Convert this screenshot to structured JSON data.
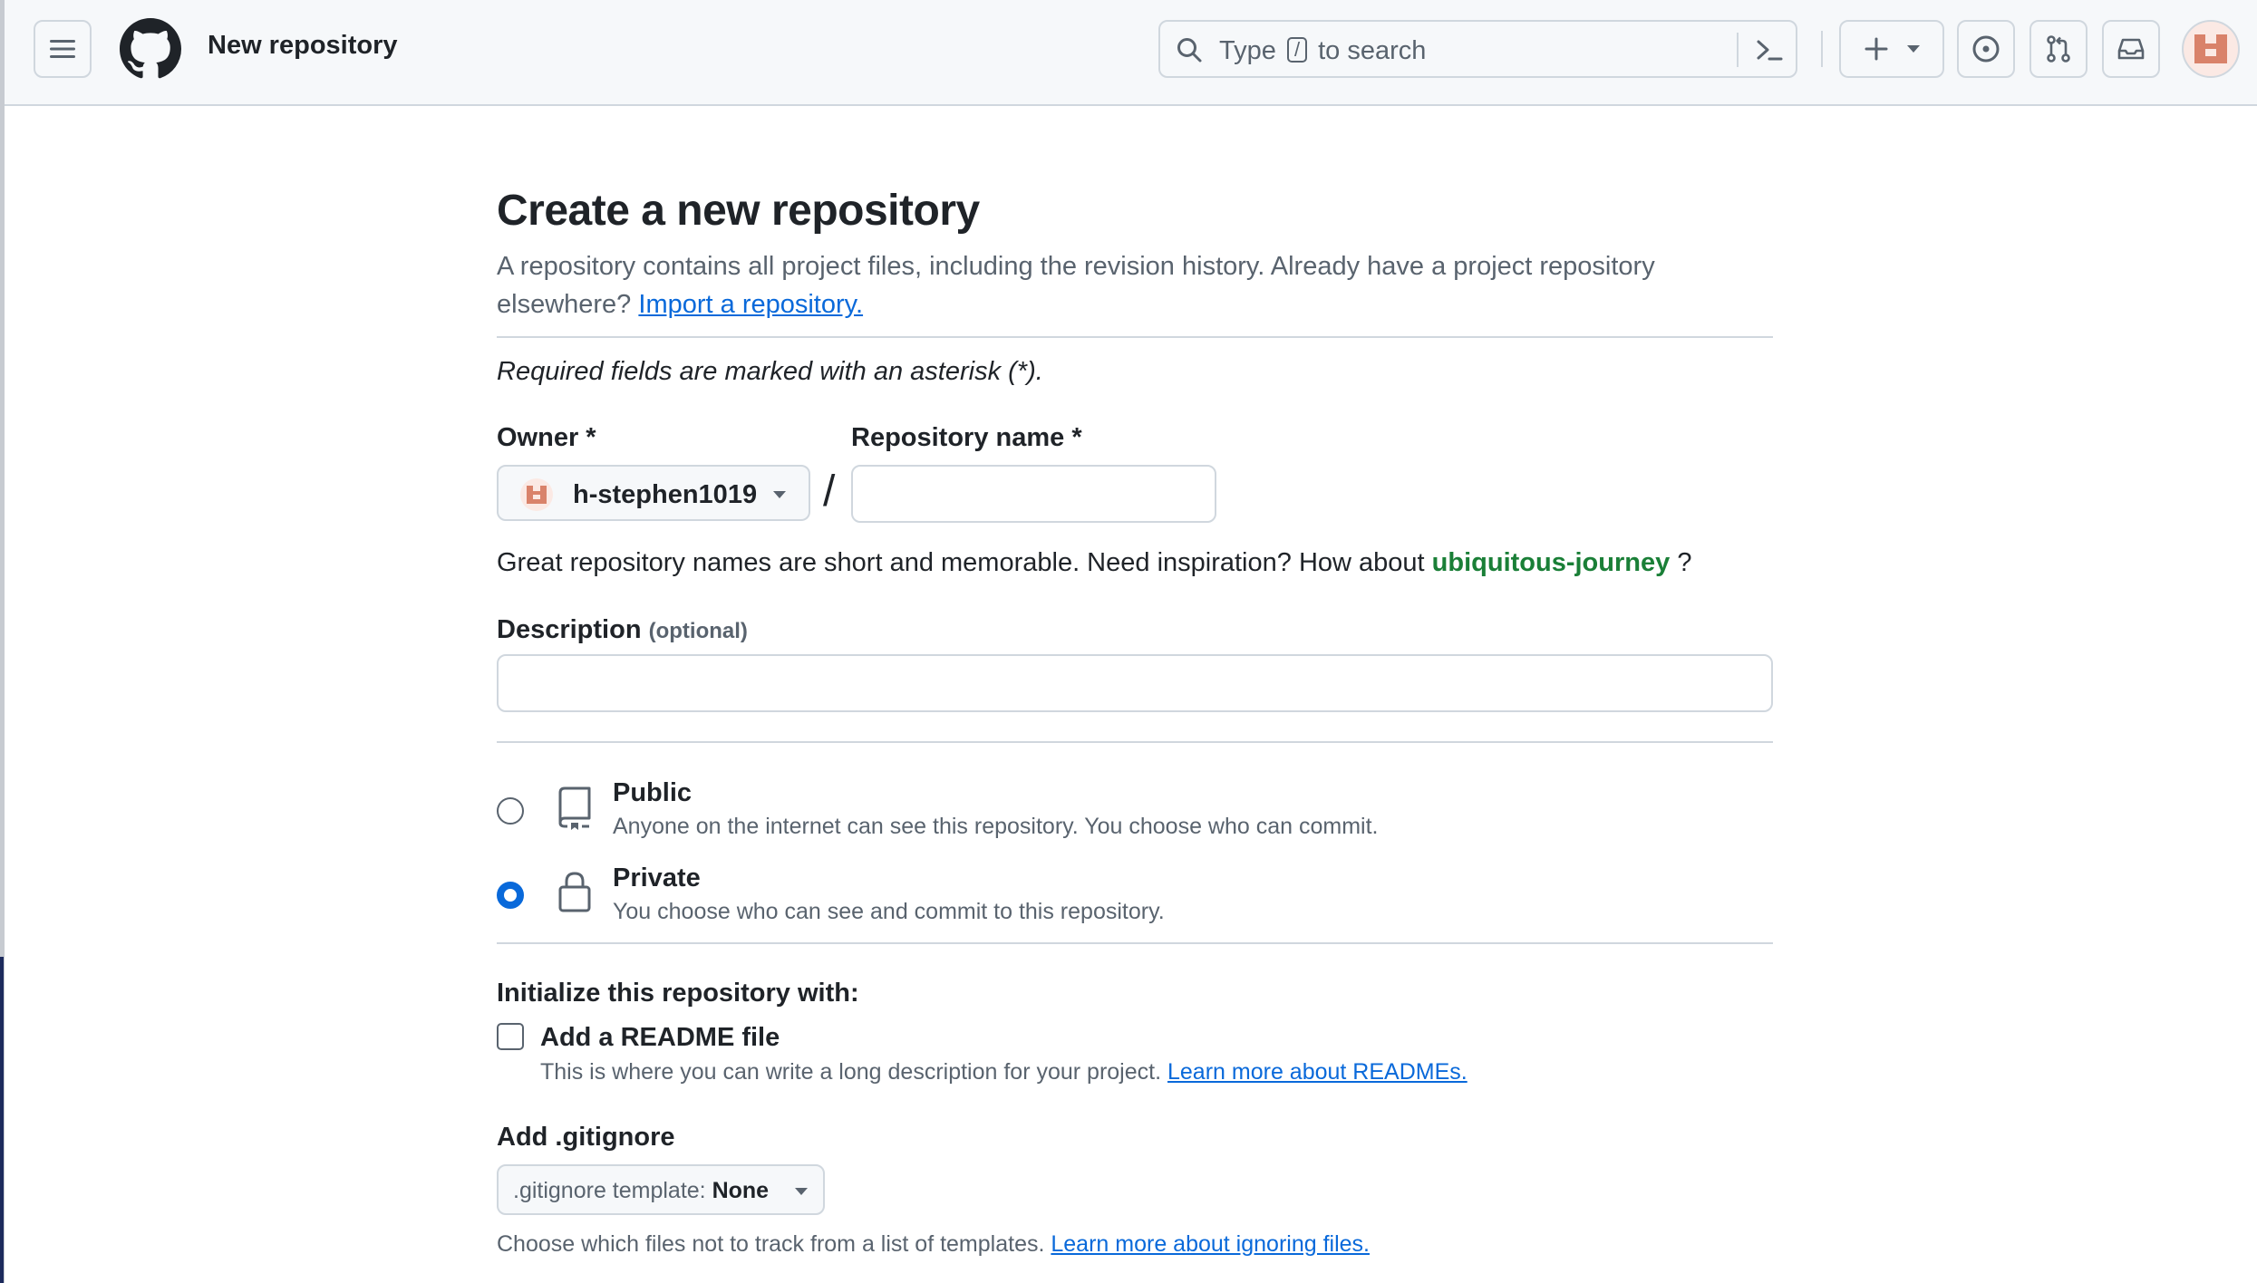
{
  "header": {
    "page_context": "New repository",
    "search": {
      "text_before": "Type",
      "key": "/",
      "text_after": "to search"
    },
    "icons": [
      "hamburger-icon",
      "github-logo-icon",
      "search-icon",
      "command-palette-icon",
      "plus-icon",
      "issues-icon",
      "pull-requests-icon",
      "inbox-icon"
    ]
  },
  "main": {
    "title": "Create a new repository",
    "lead_text": "A repository contains all project files, including the revision history. Already have a project repository elsewhere?",
    "import_link": "Import a repository.",
    "required_note": "Required fields are marked with an asterisk (*).",
    "owner": {
      "label": "Owner *",
      "value": "h-stephen1019"
    },
    "repo_name": {
      "label": "Repository name *",
      "value": ""
    },
    "slash": "/",
    "suggestion": {
      "prefix": "Great repository names are short and memorable. Need inspiration? How about",
      "name": "ubiquitous-journey",
      "suffix": "?"
    },
    "description": {
      "label": "Description",
      "optional": "(optional)",
      "value": ""
    },
    "visibility": {
      "selected": "Private",
      "options": [
        {
          "title": "Public",
          "desc": "Anyone on the internet can see this repository. You choose who can commit."
        },
        {
          "title": "Private",
          "desc": "You choose who can see and commit to this repository."
        }
      ]
    },
    "initialize": {
      "title": "Initialize this repository with:",
      "readme_label": "Add a README file",
      "readme_checked": false,
      "readme_desc": "This is where you can write a long description for your project.",
      "readme_link": "Learn more about READMEs."
    },
    "gitignore": {
      "title": "Add .gitignore",
      "template_label": ".gitignore template:",
      "template_value": "None",
      "desc": "Choose which files not to track from a list of templates.",
      "link": "Learn more about ignoring files."
    }
  },
  "colors": {
    "accent": "#0969da",
    "suggestion": "#1a7f37",
    "border": "#d0d7de",
    "muted": "#59636e"
  }
}
